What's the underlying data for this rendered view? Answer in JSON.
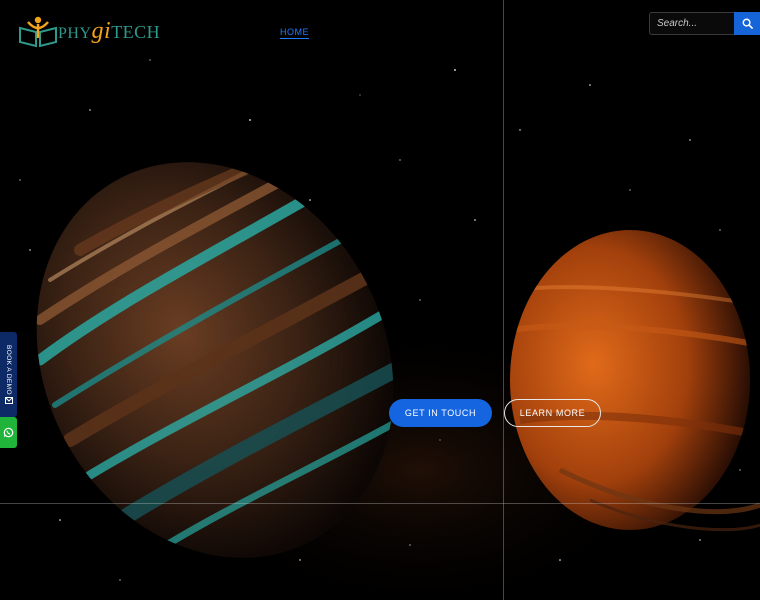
{
  "brand": {
    "part1": "PHY",
    "part2": "gi",
    "part3": "TECH",
    "logo_icon": "reader-book-icon"
  },
  "nav": {
    "items": [
      {
        "label": "HOME",
        "active": true
      }
    ]
  },
  "search": {
    "placeholder": "Search...",
    "value": "",
    "icon": "search-icon"
  },
  "hero": {
    "primary_cta": "GET IN TOUCH",
    "secondary_cta": "LEARN MORE"
  },
  "side": {
    "book_label": "BOOK A DEMO",
    "book_icon": "mail-icon",
    "whatsapp_icon": "whatsapp-icon"
  },
  "colors": {
    "accent_blue": "#1565e0",
    "whatsapp_green": "#20b43a",
    "side_tab_navy": "#0d2a66",
    "logo_teal": "#2f9a8c",
    "logo_orange": "#f3a21c"
  }
}
